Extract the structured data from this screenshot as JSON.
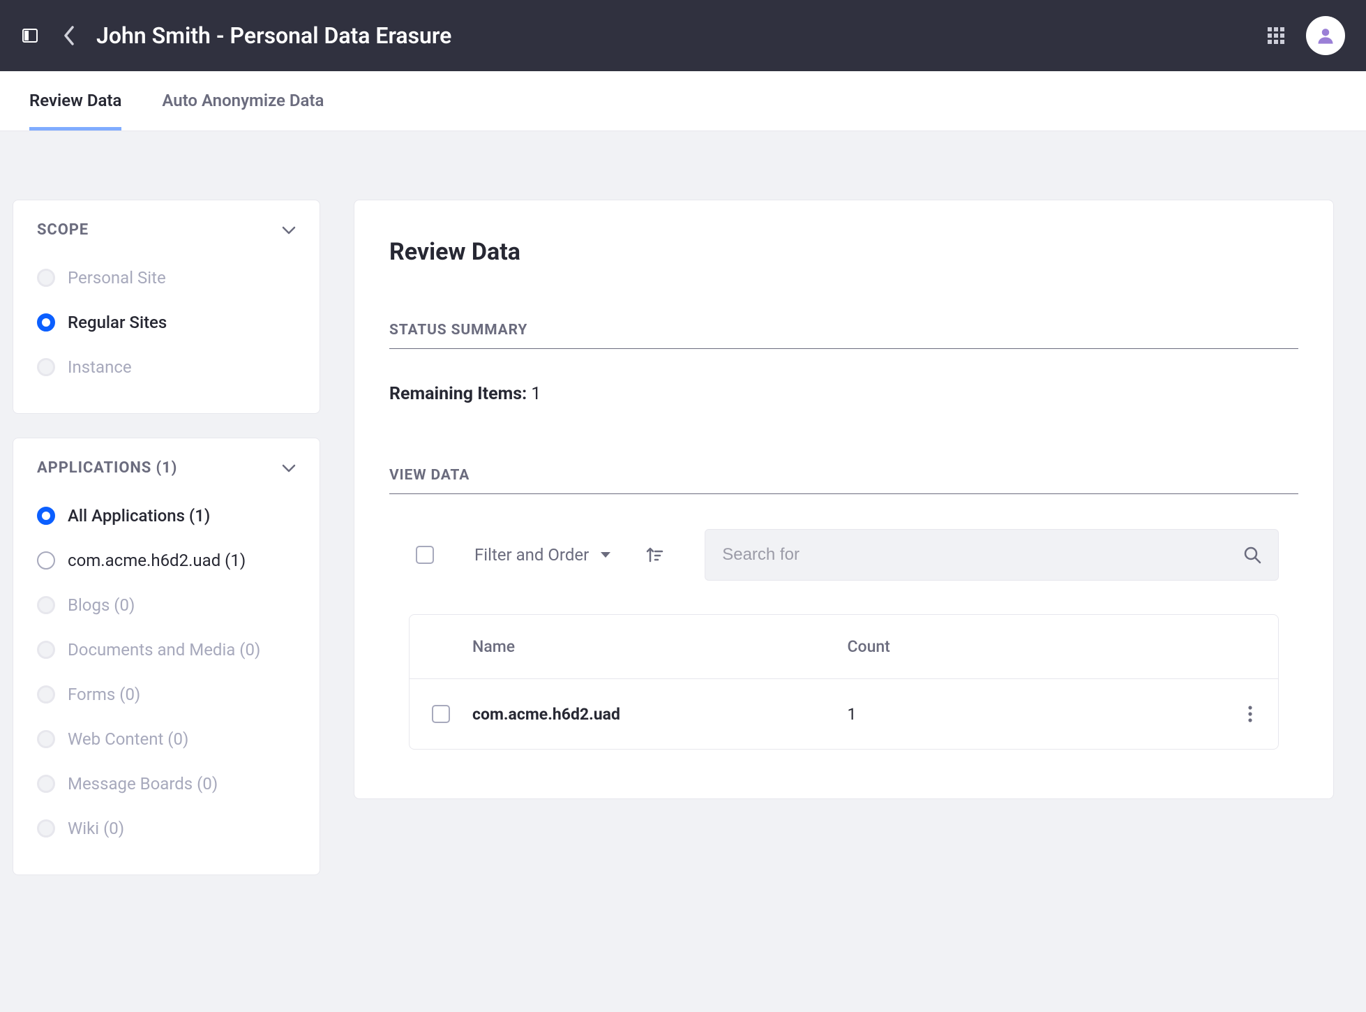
{
  "header": {
    "title": "John Smith - Personal Data Erasure"
  },
  "tabs": [
    {
      "label": "Review Data",
      "active": true
    },
    {
      "label": "Auto Anonymize Data",
      "active": false
    }
  ],
  "sidebar": {
    "scope": {
      "heading": "SCOPE",
      "items": [
        {
          "label": "Personal Site",
          "state": "disabled"
        },
        {
          "label": "Regular Sites",
          "state": "selected"
        },
        {
          "label": "Instance",
          "state": "disabled"
        }
      ]
    },
    "applications": {
      "heading": "APPLICATIONS (1)",
      "items": [
        {
          "label": "All Applications (1)",
          "state": "selected"
        },
        {
          "label": "com.acme.h6d2.uad (1)",
          "state": "enabled"
        },
        {
          "label": "Blogs (0)",
          "state": "disabled"
        },
        {
          "label": "Documents and Media (0)",
          "state": "disabled"
        },
        {
          "label": "Forms (0)",
          "state": "disabled"
        },
        {
          "label": "Web Content (0)",
          "state": "disabled"
        },
        {
          "label": "Message Boards (0)",
          "state": "disabled"
        },
        {
          "label": "Wiki (0)",
          "state": "disabled"
        }
      ]
    }
  },
  "main": {
    "page_title": "Review Data",
    "status_heading": "STATUS SUMMARY",
    "remaining_label": "Remaining Items:",
    "remaining_value": "1",
    "view_heading": "VIEW DATA",
    "toolbar": {
      "filter_label": "Filter and Order",
      "search_placeholder": "Search for"
    },
    "table": {
      "columns": {
        "name": "Name",
        "count": "Count"
      },
      "rows": [
        {
          "name": "com.acme.h6d2.uad",
          "count": "1"
        }
      ]
    }
  }
}
